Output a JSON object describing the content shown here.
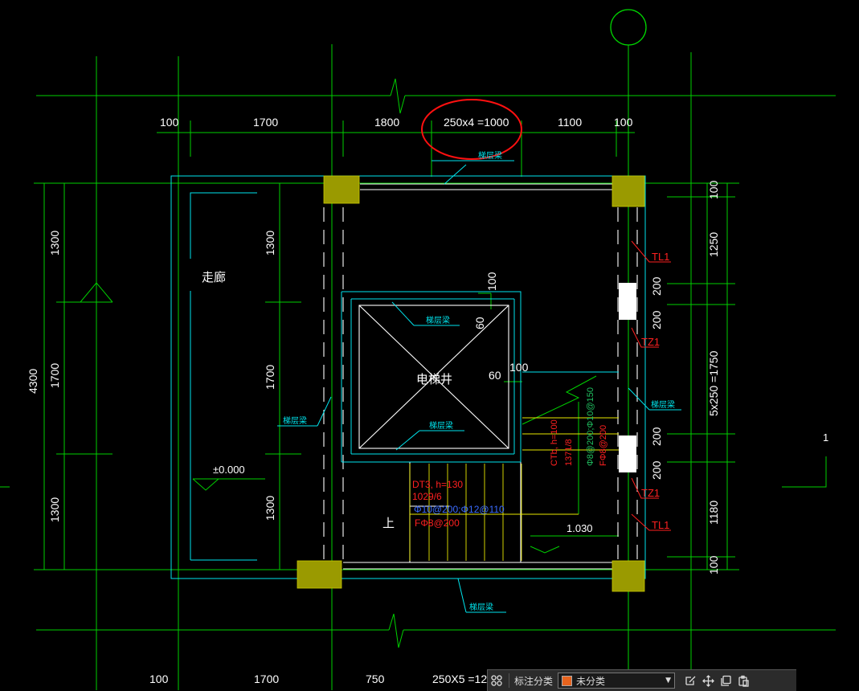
{
  "drawing": {
    "top_dims": [
      "100",
      "1700",
      "1800",
      "250x4 =1000",
      "1100",
      "100"
    ],
    "bottom_dims": [
      "100",
      "1700",
      "750",
      "250X5 =12"
    ],
    "left_outer": "4300",
    "left_inner": [
      "1300",
      "1700",
      "1300"
    ],
    "mid_vertical": [
      "1300",
      "1700",
      "1300"
    ],
    "right_dims": [
      "100",
      "1250",
      "200",
      "200",
      "5x250 =1750",
      "200",
      "200",
      "1180",
      "100"
    ],
    "shaft_small": [
      "100",
      "60",
      "60",
      "100"
    ],
    "corridor": "走廊",
    "elevator_shaft": "电梯井",
    "floor_beam": "梯层梁",
    "elevation_zero": "±0.000",
    "elevation_mid": "1.030",
    "up_mark": "上",
    "tags": {
      "tl1_top": "TL1",
      "tz1_top": "TZ1",
      "tz1_bottom": "TZ1",
      "tl1_bottom": "TL1"
    },
    "dt3": [
      "DT3, h=130",
      "1029/6",
      "Φ10@200;Φ12@110",
      "FΦ8@200"
    ],
    "ctb": [
      "CTb, h=100",
      "1371/8",
      "Φ8@200;Φ10@150",
      "FΦ8@200"
    ],
    "side_label": "1"
  },
  "toolbar": {
    "category_label": "标注分类",
    "selected_category": "未分类",
    "swatch_color": "#e8641e"
  },
  "colors": {
    "background": "#000000",
    "grid": "#00e000",
    "structure": "#ffffff",
    "annotation": "#00e5ee",
    "tag": "#ff2020",
    "column": "#9a9a00"
  }
}
